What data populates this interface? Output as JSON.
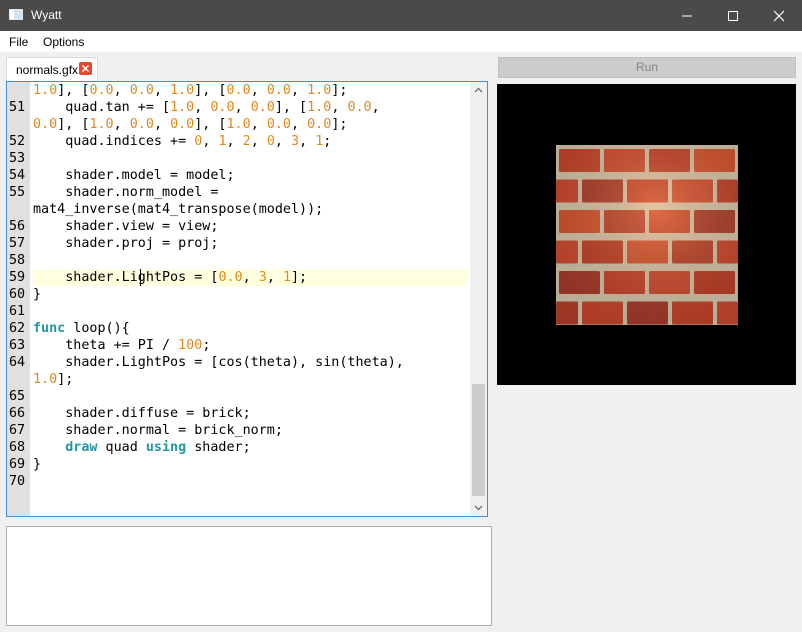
{
  "window": {
    "title": "Wyatt"
  },
  "menu": {
    "file": "File",
    "options": "Options"
  },
  "tab": {
    "label": "normals.gfx"
  },
  "run_button": {
    "label": "Run"
  },
  "editor": {
    "lines": [
      {
        "n": "",
        "t": "1.0], [0.0, 0.0, 1.0], [0.0, 0.0, 1.0];"
      },
      {
        "n": "51",
        "t": "    quad.tan += [1.0, 0.0, 0.0], [1.0, 0.0,"
      },
      {
        "n": "",
        "t": "0.0], [1.0, 0.0, 0.0], [1.0, 0.0, 0.0];"
      },
      {
        "n": "52",
        "t": "    quad.indices += 0, 1, 2, 0, 3, 1;"
      },
      {
        "n": "53",
        "t": ""
      },
      {
        "n": "54",
        "t": "    shader.model = model;"
      },
      {
        "n": "55",
        "t": "    shader.norm_model ="
      },
      {
        "n": "",
        "t": "mat4_inverse(mat4_transpose(model));"
      },
      {
        "n": "56",
        "t": "    shader.view = view;"
      },
      {
        "n": "57",
        "t": "    shader.proj = proj;"
      },
      {
        "n": "58",
        "t": ""
      },
      {
        "n": "59",
        "t": "    shader.LightPos = [0.0, 3, 1];"
      },
      {
        "n": "60",
        "t": "}"
      },
      {
        "n": "61",
        "t": ""
      },
      {
        "n": "62",
        "t": "func loop(){"
      },
      {
        "n": "63",
        "t": "    theta += PI / 100;"
      },
      {
        "n": "64",
        "t": "    shader.LightPos = [cos(theta), sin(theta),"
      },
      {
        "n": "",
        "t": "1.0];"
      },
      {
        "n": "65",
        "t": ""
      },
      {
        "n": "66",
        "t": "    shader.diffuse = brick;"
      },
      {
        "n": "67",
        "t": "    shader.normal = brick_norm;"
      },
      {
        "n": "68",
        "t": "    draw quad using shader;"
      },
      {
        "n": "69",
        "t": "}"
      },
      {
        "n": "70",
        "t": ""
      }
    ],
    "current_line": "59"
  },
  "colors": {
    "number": "#e08a1d",
    "keyword": "#2596a6",
    "current_line_bg": "#ffffe0",
    "brick": "#c8432b",
    "mortar": "#d8cdb4"
  }
}
